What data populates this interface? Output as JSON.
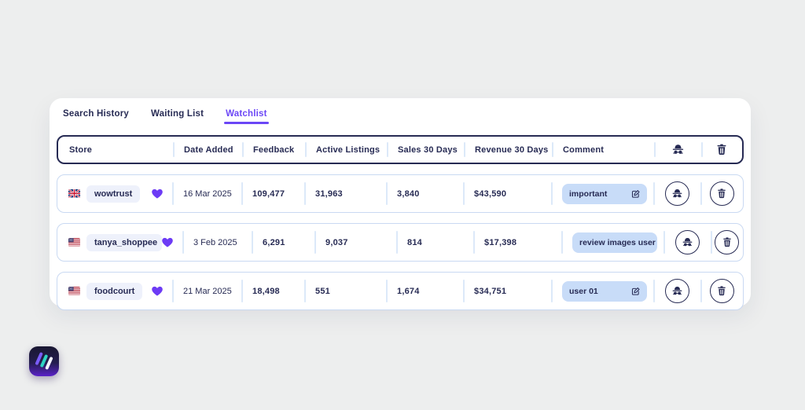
{
  "tabs": [
    {
      "label": "Search History",
      "active": false
    },
    {
      "label": "Waiting List",
      "active": false
    },
    {
      "label": "Watchlist",
      "active": true
    }
  ],
  "table": {
    "headers": {
      "store": "Store",
      "date_added": "Date Added",
      "feedback": "Feedback",
      "active_listings": "Active Listings",
      "sales_30_days": "Sales 30 Days",
      "revenue_30_days": "Revenue 30 Days",
      "comment": "Comment",
      "spy_column_icon": "spy-incognito-icon",
      "delete_column_icon": "trash-icon"
    },
    "rows": [
      {
        "flag": "GB",
        "store": "wowtrust",
        "favorited": true,
        "date_added": "16 Mar 2025",
        "feedback": "109,477",
        "active_listings": "31,963",
        "sales_30_days": "3,840",
        "revenue_30_days": "$43,590",
        "comment": "important"
      },
      {
        "flag": "US",
        "store": "tanya_shoppee",
        "favorited": true,
        "date_added": "3 Feb 2025",
        "feedback": "6,291",
        "active_listings": "9,037",
        "sales_30_days": "814",
        "revenue_30_days": "$17,398",
        "comment": "review images user"
      },
      {
        "flag": "US",
        "store": "foodcourt",
        "favorited": true,
        "date_added": "21 Mar 2025",
        "feedback": "18,498",
        "active_listings": "551",
        "sales_30_days": "1,674",
        "revenue_30_days": "$34,751",
        "comment": "user 01"
      }
    ]
  },
  "colors": {
    "accent_purple": "#6b46f6",
    "navy": "#272b54",
    "comment_chip_bg": "#c8dcf8",
    "store_chip_bg": "#eef1fb",
    "row_border": "#c9d9f2",
    "header_border": "#272b54",
    "separator": "#dce9f9",
    "page_background": "#edeeee"
  }
}
